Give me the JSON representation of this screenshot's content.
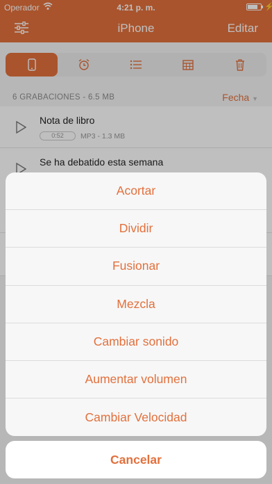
{
  "status_bar": {
    "carrier": "Operador",
    "time": "4:21 p. m."
  },
  "nav": {
    "title": "iPhone",
    "edit_label": "Editar"
  },
  "toolbar": {
    "segments": [
      "phone-icon",
      "alarm-icon",
      "list-icon",
      "calendar-icon",
      "trash-icon"
    ],
    "active_index": 0
  },
  "list": {
    "summary": "6 GRABACIONES - 6.5 MB",
    "sort_label": "Fecha",
    "items": [
      {
        "title": "Nota de libro",
        "duration": "0:52",
        "meta": "MP3 - 1.3 MB"
      },
      {
        "title": "Se ha debatido esta semana"
      }
    ]
  },
  "action_sheet": {
    "actions": [
      "Acortar",
      "Dividir",
      "Fusionar",
      "Mezcla",
      "Cambiar sonido",
      "Aumentar volumen",
      "Cambiar Velocidad"
    ],
    "cancel_label": "Cancelar"
  },
  "colors": {
    "accent": "#e2703c",
    "background": "#f4f4f4"
  }
}
